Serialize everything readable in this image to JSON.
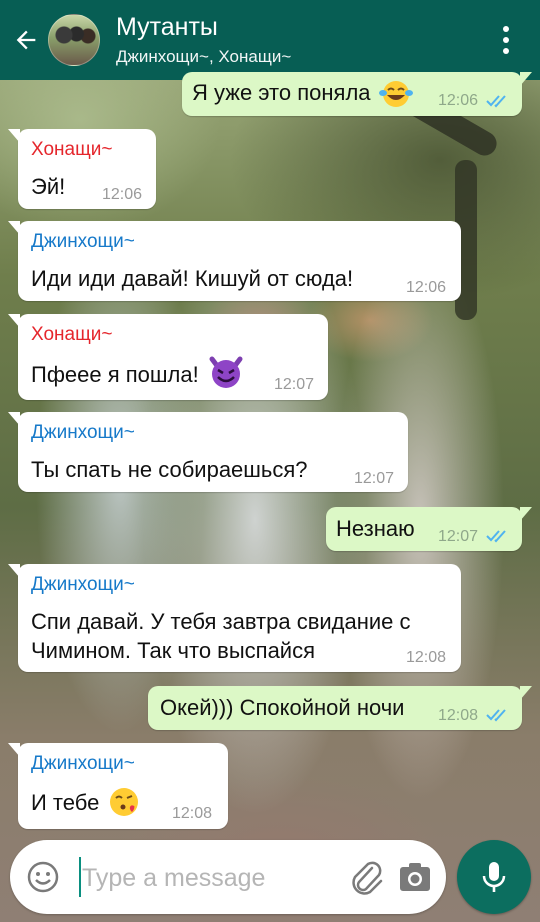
{
  "header": {
    "title": "Мутанты",
    "subtitle": "Джинхощи~, Хонащи~"
  },
  "colors": {
    "header": "#075e54",
    "incoming_bubble": "#ffffff",
    "outgoing_bubble": "#dcf8c6",
    "sender_red": "#e5262c",
    "sender_blue": "#1679c9",
    "read_ticks": "#4fb3f0",
    "mic_button": "#0c6e5f"
  },
  "messages": [
    {
      "direction": "out",
      "text": "Я уже это поняла",
      "emoji": "face-with-tears-of-joy",
      "time": "12:06",
      "status": "read"
    },
    {
      "direction": "in",
      "sender": "Хонащи~",
      "text": "Эй!",
      "time": "12:06"
    },
    {
      "direction": "in",
      "sender": "Джинхощи~",
      "text": "Иди иди давай! Кишуй от сюда!",
      "time": "12:06"
    },
    {
      "direction": "in",
      "sender": "Хонащи~",
      "text": "Пфеее я пошла!",
      "emoji": "smiling-imp",
      "time": "12:07"
    },
    {
      "direction": "in",
      "sender": "Джинхощи~",
      "text": "Ты спать не собираешься?",
      "time": "12:07"
    },
    {
      "direction": "out",
      "text": "Незнаю",
      "time": "12:07",
      "status": "read"
    },
    {
      "direction": "in",
      "sender": "Джинхощи~",
      "text_line1": "Спи давай. У тебя завтра свидание с",
      "text_line2": "Чимином. Так что выспайся",
      "time": "12:08"
    },
    {
      "direction": "out",
      "text": "Окей))) Спокойной ночи",
      "time": "12:08",
      "status": "read"
    },
    {
      "direction": "in",
      "sender": "Джинхощи~",
      "text": "И тебе",
      "emoji": "face-blowing-kiss",
      "time": "12:08"
    }
  ],
  "composer": {
    "placeholder": "Type a message",
    "value": ""
  },
  "icons": {
    "back": "arrow-left-icon",
    "menu": "more-vertical-icon",
    "emoji": "smiley-icon",
    "attach": "paperclip-icon",
    "camera": "camera-icon",
    "mic": "microphone-icon"
  }
}
